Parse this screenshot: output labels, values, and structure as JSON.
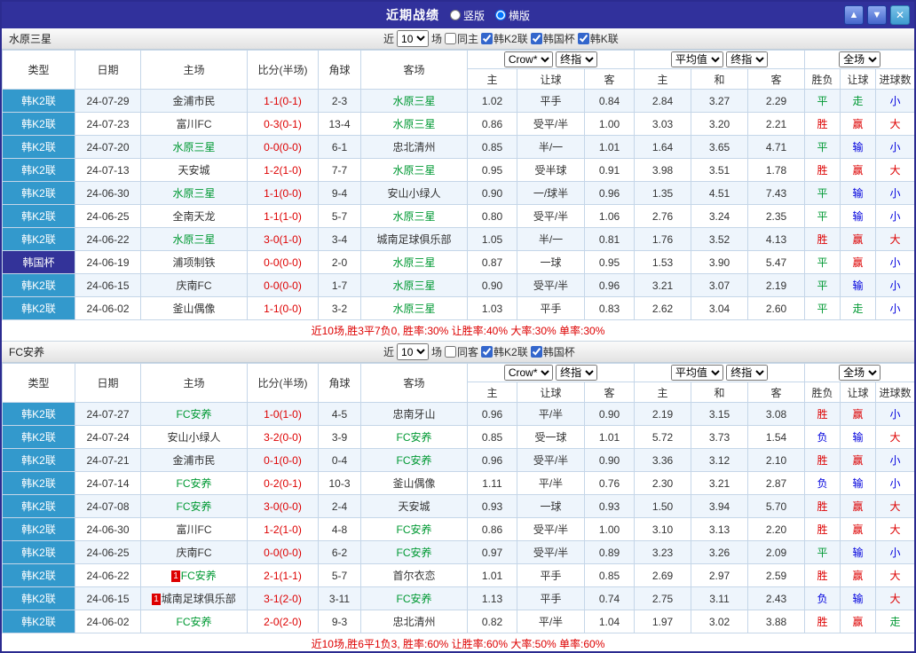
{
  "titlebar": {
    "title": "近期战绩",
    "radio_vertical": "竖版",
    "radio_horizontal": "横版",
    "up_icon": "▲",
    "down_icon": "▼",
    "close_icon": "✕"
  },
  "controls": {
    "recent_label": "近",
    "count": "10",
    "matches_label": "场",
    "bookmaker": "Crow*",
    "final_odds": "终指",
    "average": "平均值",
    "full_match": "全场"
  },
  "columns": {
    "type": "类型",
    "date": "日期",
    "home": "主场",
    "score": "比分(半场)",
    "corner": "角球",
    "away": "客场",
    "asian": [
      "主",
      "让球",
      "客"
    ],
    "euro": [
      "主",
      "和",
      "客"
    ],
    "result": [
      "胜负",
      "让球",
      "进球数"
    ]
  },
  "colors": {
    "titlebar_bg": "#31319c",
    "league_bg": "#3399cc",
    "cup_bg": "#333399",
    "team_green": "#009933",
    "score_red": "#dd0000",
    "summary_red": "#dd0000",
    "border": "#c5d6e8",
    "row_alt": "#eef5fc"
  },
  "value_colors": {
    "胜": "#dd0000",
    "赢": "#dd0000",
    "大": "#dd0000",
    "平": "#009933",
    "走": "#009933",
    "负": "#0000dd",
    "输": "#0000dd",
    "小": "#0000dd"
  },
  "sections": [
    {
      "team": "水原三星",
      "same_label": "同主",
      "leagues": [
        "韩K2联",
        "韩国杯",
        "韩K联"
      ],
      "summary": "近10场,胜3平7负0, 胜率:30% 让胜率:40% 大率:30% 单率:30%",
      "rows": [
        {
          "league": "韩K2联",
          "date": "24-07-29",
          "home": "金浦市民",
          "score": "1-1(0-1)",
          "corner": "2-3",
          "away": "水原三星",
          "away_green": true,
          "asian": [
            "1.02",
            "平手",
            "0.84"
          ],
          "euro": [
            "2.84",
            "3.27",
            "2.29"
          ],
          "verdict": [
            "平",
            "走",
            "小"
          ]
        },
        {
          "league": "韩K2联",
          "date": "24-07-23",
          "home": "富川FC",
          "score": "0-3(0-1)",
          "corner": "13-4",
          "away": "水原三星",
          "away_green": true,
          "asian": [
            "0.86",
            "受平/半",
            "1.00"
          ],
          "euro": [
            "3.03",
            "3.20",
            "2.21"
          ],
          "verdict": [
            "胜",
            "赢",
            "大"
          ]
        },
        {
          "league": "韩K2联",
          "date": "24-07-20",
          "home": "水原三星",
          "home_green": true,
          "score": "0-0(0-0)",
          "corner": "6-1",
          "away": "忠北清州",
          "asian": [
            "0.85",
            "半/一",
            "1.01"
          ],
          "euro": [
            "1.64",
            "3.65",
            "4.71"
          ],
          "verdict": [
            "平",
            "输",
            "小"
          ]
        },
        {
          "league": "韩K2联",
          "date": "24-07-13",
          "home": "天安城",
          "score": "1-2(1-0)",
          "corner": "7-7",
          "away": "水原三星",
          "away_green": true,
          "asian": [
            "0.95",
            "受半球",
            "0.91"
          ],
          "euro": [
            "3.98",
            "3.51",
            "1.78"
          ],
          "verdict": [
            "胜",
            "赢",
            "大"
          ]
        },
        {
          "league": "韩K2联",
          "date": "24-06-30",
          "home": "水原三星",
          "home_green": true,
          "score": "1-1(0-0)",
          "corner": "9-4",
          "away": "安山小绿人",
          "asian": [
            "0.90",
            "一/球半",
            "0.96"
          ],
          "euro": [
            "1.35",
            "4.51",
            "7.43"
          ],
          "verdict": [
            "平",
            "输",
            "小"
          ]
        },
        {
          "league": "韩K2联",
          "date": "24-06-25",
          "home": "全南天龙",
          "score": "1-1(1-0)",
          "corner": "5-7",
          "away": "水原三星",
          "away_green": true,
          "asian": [
            "0.80",
            "受平/半",
            "1.06"
          ],
          "euro": [
            "2.76",
            "3.24",
            "2.35"
          ],
          "verdict": [
            "平",
            "输",
            "小"
          ]
        },
        {
          "league": "韩K2联",
          "date": "24-06-22",
          "home": "水原三星",
          "home_green": true,
          "score": "3-0(1-0)",
          "corner": "3-4",
          "away": "城南足球俱乐部",
          "asian": [
            "1.05",
            "半/一",
            "0.81"
          ],
          "euro": [
            "1.76",
            "3.52",
            "4.13"
          ],
          "verdict": [
            "胜",
            "赢",
            "大"
          ]
        },
        {
          "league": "韩国杯",
          "cup": true,
          "date": "24-06-19",
          "home": "浦项制铁",
          "score": "0-0(0-0)",
          "corner": "2-0",
          "away": "水原三星",
          "away_green": true,
          "asian": [
            "0.87",
            "一球",
            "0.95"
          ],
          "euro": [
            "1.53",
            "3.90",
            "5.47"
          ],
          "verdict": [
            "平",
            "赢",
            "小"
          ]
        },
        {
          "league": "韩K2联",
          "date": "24-06-15",
          "home": "庆南FC",
          "score": "0-0(0-0)",
          "corner": "1-7",
          "away": "水原三星",
          "away_green": true,
          "asian": [
            "0.90",
            "受平/半",
            "0.96"
          ],
          "euro": [
            "3.21",
            "3.07",
            "2.19"
          ],
          "verdict": [
            "平",
            "输",
            "小"
          ]
        },
        {
          "league": "韩K2联",
          "date": "24-06-02",
          "home": "釜山偶像",
          "score": "1-1(0-0)",
          "corner": "3-2",
          "away": "水原三星",
          "away_green": true,
          "asian": [
            "1.03",
            "平手",
            "0.83"
          ],
          "euro": [
            "2.62",
            "3.04",
            "2.60"
          ],
          "verdict": [
            "平",
            "走",
            "小"
          ]
        }
      ]
    },
    {
      "team": "FC安养",
      "same_label": "同客",
      "leagues": [
        "韩K2联",
        "韩国杯"
      ],
      "summary": "近10场,胜6平1负3, 胜率:60% 让胜率:60% 大率:50% 单率:60%",
      "rows": [
        {
          "league": "韩K2联",
          "date": "24-07-27",
          "home": "FC安养",
          "home_green": true,
          "score": "1-0(1-0)",
          "corner": "4-5",
          "away": "忠南牙山",
          "asian": [
            "0.96",
            "平/半",
            "0.90"
          ],
          "euro": [
            "2.19",
            "3.15",
            "3.08"
          ],
          "verdict": [
            "胜",
            "赢",
            "小"
          ]
        },
        {
          "league": "韩K2联",
          "date": "24-07-24",
          "home": "安山小绿人",
          "score": "3-2(0-0)",
          "corner": "3-9",
          "away": "FC安养",
          "away_green": true,
          "asian": [
            "0.85",
            "受一球",
            "1.01"
          ],
          "euro": [
            "5.72",
            "3.73",
            "1.54"
          ],
          "verdict": [
            "负",
            "输",
            "大"
          ]
        },
        {
          "league": "韩K2联",
          "date": "24-07-21",
          "home": "金浦市民",
          "score": "0-1(0-0)",
          "corner": "0-4",
          "away": "FC安养",
          "away_green": true,
          "asian": [
            "0.96",
            "受平/半",
            "0.90"
          ],
          "euro": [
            "3.36",
            "3.12",
            "2.10"
          ],
          "verdict": [
            "胜",
            "赢",
            "小"
          ]
        },
        {
          "league": "韩K2联",
          "date": "24-07-14",
          "home": "FC安养",
          "home_green": true,
          "score": "0-2(0-1)",
          "corner": "10-3",
          "away": "釜山偶像",
          "asian": [
            "1.11",
            "平/半",
            "0.76"
          ],
          "euro": [
            "2.30",
            "3.21",
            "2.87"
          ],
          "verdict": [
            "负",
            "输",
            "小"
          ]
        },
        {
          "league": "韩K2联",
          "date": "24-07-08",
          "home": "FC安养",
          "home_green": true,
          "score": "3-0(0-0)",
          "corner": "2-4",
          "away": "天安城",
          "asian": [
            "0.93",
            "一球",
            "0.93"
          ],
          "euro": [
            "1.50",
            "3.94",
            "5.70"
          ],
          "verdict": [
            "胜",
            "赢",
            "大"
          ]
        },
        {
          "league": "韩K2联",
          "date": "24-06-30",
          "home": "富川FC",
          "score": "1-2(1-0)",
          "corner": "4-8",
          "away": "FC安养",
          "away_green": true,
          "asian": [
            "0.86",
            "受平/半",
            "1.00"
          ],
          "euro": [
            "3.10",
            "3.13",
            "2.20"
          ],
          "verdict": [
            "胜",
            "赢",
            "大"
          ]
        },
        {
          "league": "韩K2联",
          "date": "24-06-25",
          "home": "庆南FC",
          "score": "0-0(0-0)",
          "corner": "6-2",
          "away": "FC安养",
          "away_green": true,
          "asian": [
            "0.97",
            "受平/半",
            "0.89"
          ],
          "euro": [
            "3.23",
            "3.26",
            "2.09"
          ],
          "verdict": [
            "平",
            "输",
            "小"
          ]
        },
        {
          "league": "韩K2联",
          "date": "24-06-22",
          "home": "FC安养",
          "home_green": true,
          "home_badge": "1",
          "score": "2-1(1-1)",
          "corner": "5-7",
          "away": "首尔衣恋",
          "asian": [
            "1.01",
            "平手",
            "0.85"
          ],
          "euro": [
            "2.69",
            "2.97",
            "2.59"
          ],
          "verdict": [
            "胜",
            "赢",
            "大"
          ]
        },
        {
          "league": "韩K2联",
          "date": "24-06-15",
          "home": "城南足球俱乐部",
          "home_badge": "1",
          "score": "3-1(2-0)",
          "corner": "3-11",
          "away": "FC安养",
          "away_green": true,
          "asian": [
            "1.13",
            "平手",
            "0.74"
          ],
          "euro": [
            "2.75",
            "3.11",
            "2.43"
          ],
          "verdict": [
            "负",
            "输",
            "大"
          ]
        },
        {
          "league": "韩K2联",
          "date": "24-06-02",
          "home": "FC安养",
          "home_green": true,
          "score": "2-0(2-0)",
          "corner": "9-3",
          "away": "忠北清州",
          "asian": [
            "0.82",
            "平/半",
            "1.04"
          ],
          "euro": [
            "1.97",
            "3.02",
            "3.88"
          ],
          "verdict": [
            "胜",
            "赢",
            "走"
          ]
        }
      ]
    }
  ]
}
